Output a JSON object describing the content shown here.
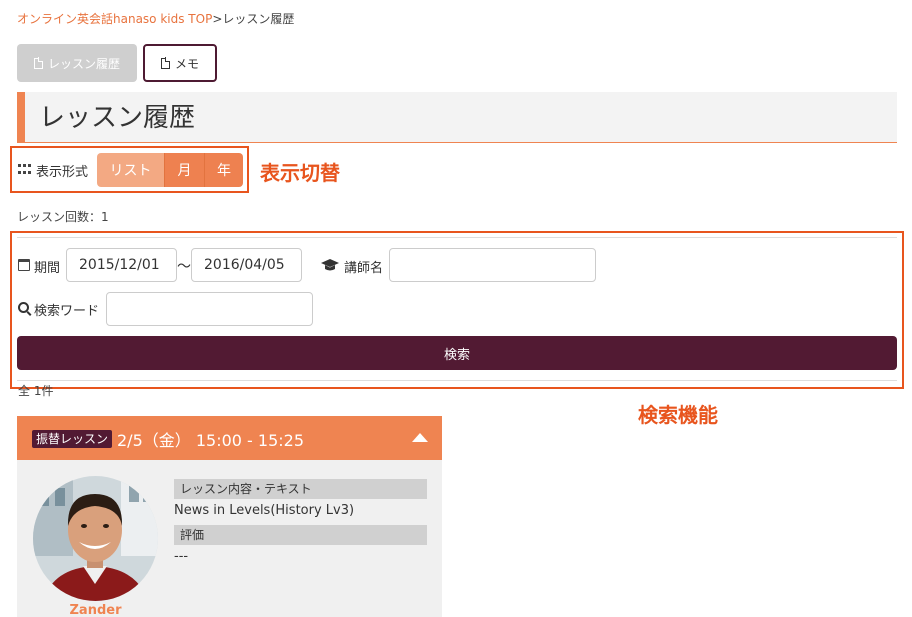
{
  "breadcrumb": {
    "home": "オンライン英会話hanaso kids TOP",
    "separator": ">",
    "current": "レッスン履歴"
  },
  "tabs": {
    "history": "レッスン履歴",
    "memo": "メモ"
  },
  "page_title": "レッスン履歴",
  "view_switch": {
    "label": "表示形式",
    "options": [
      "リスト",
      "月",
      "年"
    ],
    "selected": "リスト"
  },
  "annotations": {
    "switch": "表示切替",
    "search": "検索機能"
  },
  "lesson_count": "レッスン回数：1",
  "search": {
    "period_label": "期間",
    "date_from": "2015/12/01",
    "range_separator": "～",
    "date_to": "2016/04/05",
    "teacher_label": "講師名",
    "teacher_value": "",
    "keyword_label": "検索ワード",
    "keyword_value": "",
    "button": "検索"
  },
  "total": "全 1件",
  "lesson": {
    "badge": "振替レッスン",
    "datetime": "2/5（金） 15:00 - 15:25",
    "teacher": "Zander",
    "content_header": "レッスン内容・テキスト",
    "content_value": "News in Levels(History Lv3)",
    "rating_header": "評価",
    "rating_value": "---"
  },
  "colors": {
    "accent": "#ef8451",
    "brand_dark": "#521a33",
    "annotation": "#e8551e"
  }
}
